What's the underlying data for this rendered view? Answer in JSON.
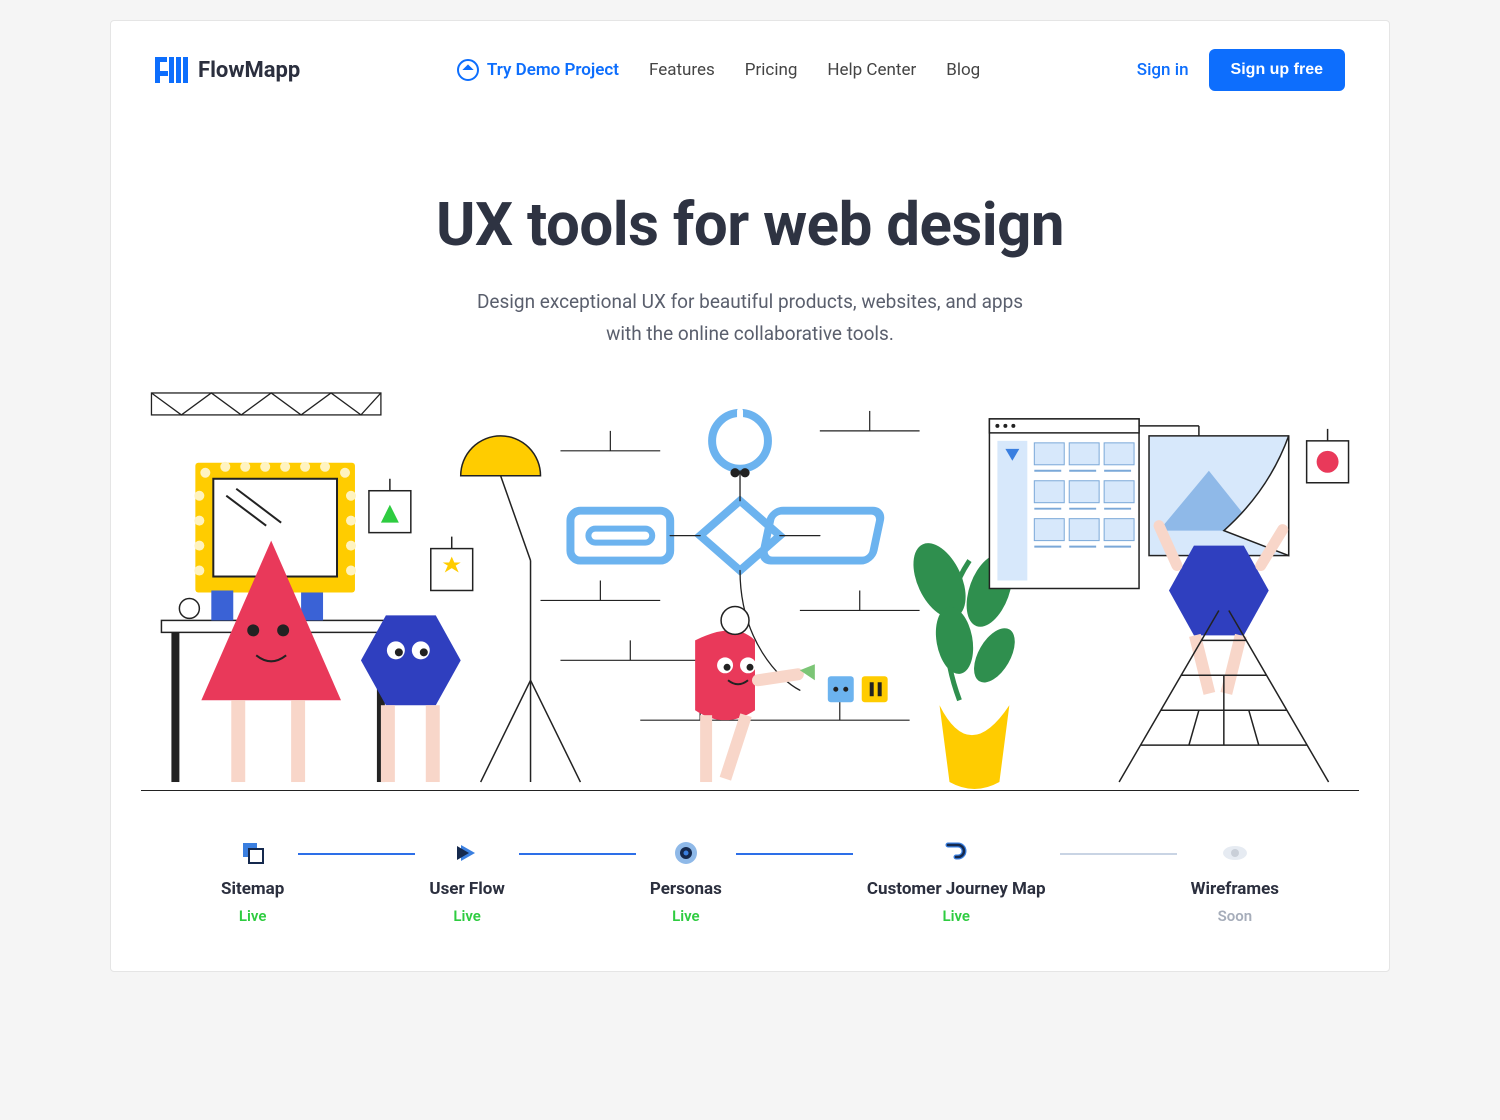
{
  "brand": {
    "name": "FlowMapp"
  },
  "nav": {
    "demo": "Try Demo Project",
    "features": "Features",
    "pricing": "Pricing",
    "help": "Help Center",
    "blog": "Blog"
  },
  "auth": {
    "signin": "Sign in",
    "signup": "Sign up free"
  },
  "hero": {
    "title": "UX tools for web design",
    "subtitle_line1": "Design exceptional UX for beautiful products, websites, and apps",
    "subtitle_line2": "with the online collaborative tools."
  },
  "features": [
    {
      "id": "sitemap",
      "label": "Sitemap",
      "status": "Live",
      "status_kind": "live"
    },
    {
      "id": "userflow",
      "label": "User Flow",
      "status": "Live",
      "status_kind": "live"
    },
    {
      "id": "personas",
      "label": "Personas",
      "status": "Live",
      "status_kind": "live"
    },
    {
      "id": "cjm",
      "label": "Customer Journey Map",
      "status": "Live",
      "status_kind": "live"
    },
    {
      "id": "wireframes",
      "label": "Wireframes",
      "status": "Soon",
      "status_kind": "soon"
    }
  ],
  "colors": {
    "accent": "#0d6efd",
    "live": "#2ecc40",
    "soon": "#a6adba"
  }
}
